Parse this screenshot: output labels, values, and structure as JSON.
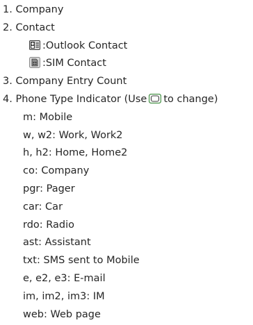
{
  "items": [
    {
      "number": "1.",
      "label": "Company"
    },
    {
      "number": "2.",
      "label": "Contact"
    },
    {
      "number": "3.",
      "label": "Company Entry Count"
    },
    {
      "number": "4.",
      "label_before": "Phone Type Indicator (Use",
      "label_after": "to change)"
    }
  ],
  "contact_types": [
    {
      "icon": "outlook-contact-icon",
      "label": ":Outlook Contact"
    },
    {
      "icon": "sim-contact-icon",
      "label": ":SIM Contact"
    }
  ],
  "change_button_icon": "navigation-key-icon",
  "phone_types": [
    "m: Mobile",
    "w, w2: Work, Work2",
    "h, h2: Home, Home2",
    "co: Company",
    "pgr: Pager",
    "car: Car",
    "rdo: Radio",
    "ast: Assistant",
    "txt: SMS sent to Mobile",
    "e, e2, e3: E-mail",
    "im, im2, im3: IM",
    "web: Web page"
  ],
  "colors": {
    "text": "#262626",
    "icon_dark": "#3a3a3a",
    "icon_mid": "#8a8a8a",
    "icon_light": "#d9d9d9",
    "button_accent": "#3c8c3c"
  }
}
